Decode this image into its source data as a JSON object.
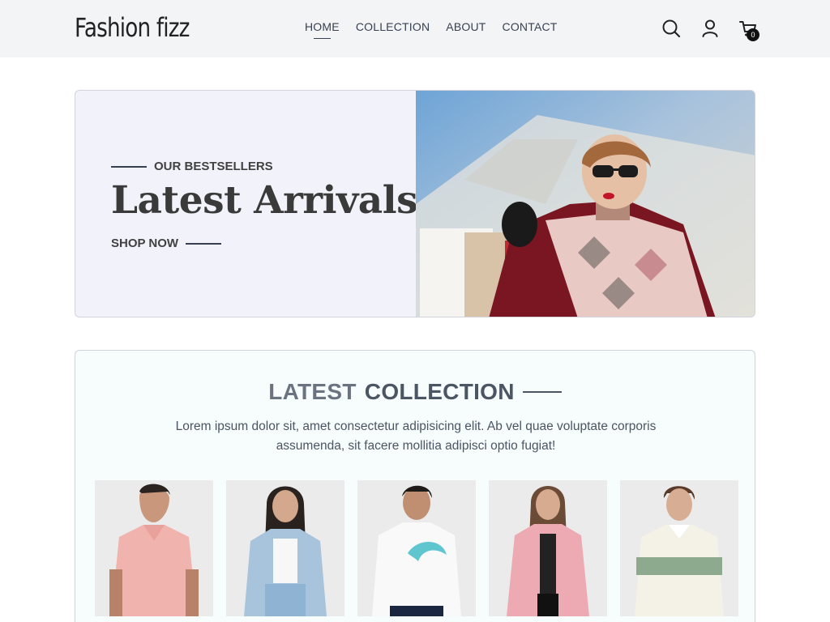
{
  "header": {
    "logo": "Fashion fizz",
    "nav": [
      {
        "label": "HOME",
        "active": true
      },
      {
        "label": "COLLECTION",
        "active": false
      },
      {
        "label": "ABOUT",
        "active": false
      },
      {
        "label": "CONTACT",
        "active": false
      }
    ],
    "icons": [
      "search-icon",
      "user-icon",
      "cart-icon"
    ],
    "cart_count": "0"
  },
  "hero": {
    "eyebrow": "OUR BESTSELLERS",
    "title": "Latest Arrivals",
    "cta": "SHOP NOW",
    "background_color": "#f2f2fa"
  },
  "collection": {
    "title_light": "LATEST",
    "title_bold": "COLLECTION",
    "description": "Lorem ipsum dolor sit, amet consectetur adipisicing elit. Ab vel quae voluptate corporis assumenda, sit facere mollitia adipisci optio fugiat!"
  },
  "colors": {
    "header_bg": "#f3f4f6",
    "text": "#374151",
    "collection_bg": "#f7fcfc"
  }
}
